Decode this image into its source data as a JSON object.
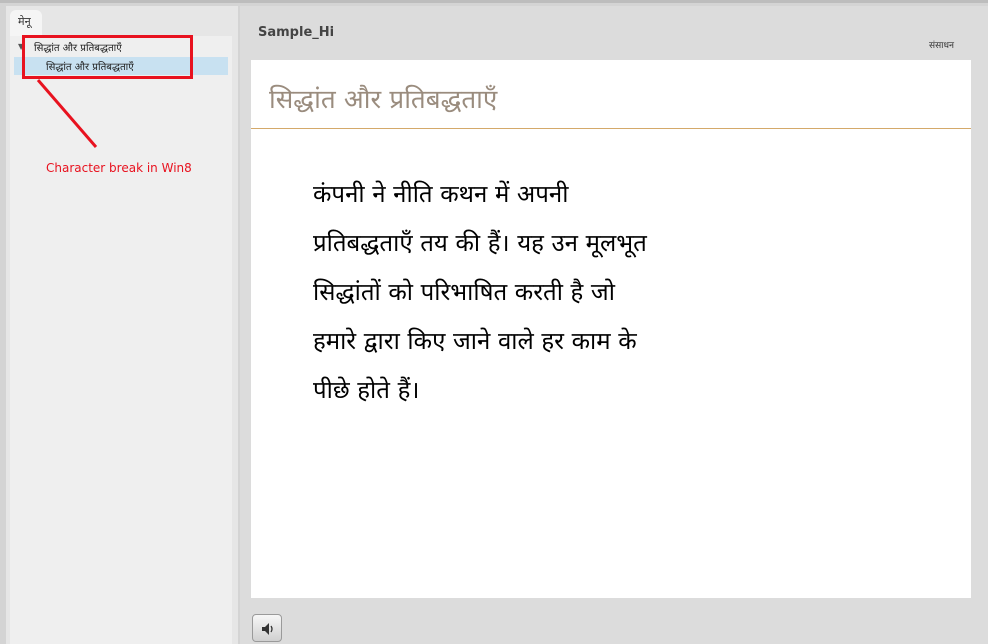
{
  "menu": {
    "tab_label": "मेनू",
    "toggle_glyph": "▼",
    "items": [
      {
        "label": "सिद्धांत और प्रतिबद्धताएँ"
      },
      {
        "label": "सिद्धांत और प्रतिबद्धताएँ"
      }
    ]
  },
  "annotation": {
    "text": "Character break in Win8",
    "color": "#e8121f"
  },
  "header": {
    "course_title": "Sample_Hi",
    "resources_label": "संसाधन"
  },
  "slide": {
    "title": "सिद्धांत और प्रतिबद्धताएँ",
    "body_lines": [
      "कंपनी ने नीति कथन में अपनी",
      "प्रतिबद्धताएँ तय की हैं। यह उन मूलभूत",
      "सिद्धांतों को परिभाषित करती है जो",
      "हमारे द्वारा किए जाने वाले हर काम के",
      "पीछे होते हैं।"
    ]
  },
  "controls": {
    "audio_icon": "speaker-icon"
  }
}
